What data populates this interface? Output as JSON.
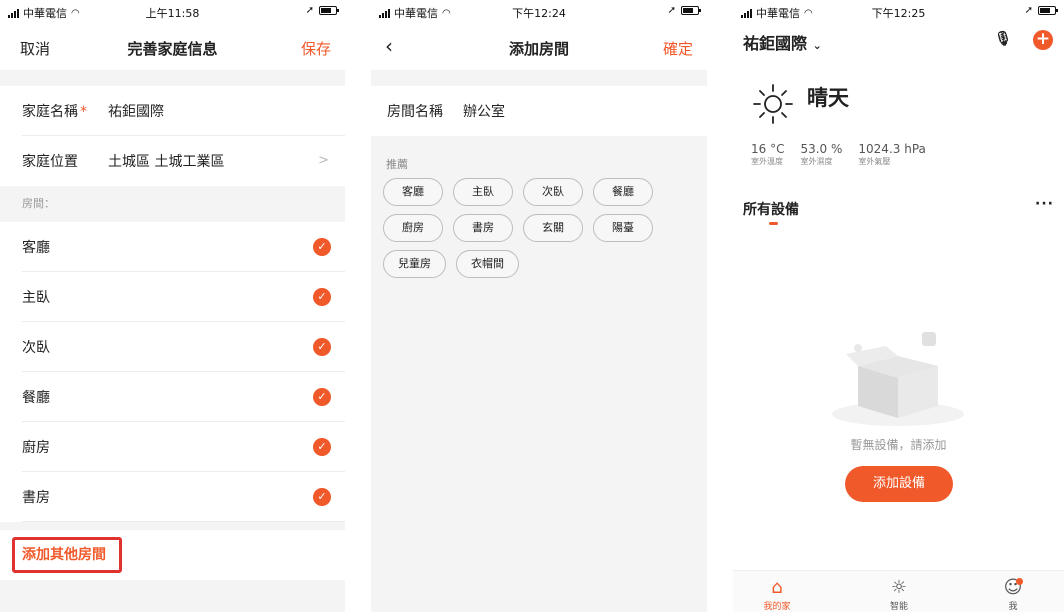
{
  "colors": {
    "accent": "#f0592a",
    "highlight_border": "#e0322e"
  },
  "screen1": {
    "status": {
      "carrier": "中華電信",
      "time": "上午11:58"
    },
    "nav": {
      "cancel": "取消",
      "title": "完善家庭信息",
      "save": "保存"
    },
    "family_name_label": "家庭名稱",
    "required_mark": "*",
    "family_name_value": "祐鉅國際",
    "location_label": "家庭位置",
    "location_value": "土城區 土城工業區",
    "rooms_header": "房間：",
    "rooms": [
      "客廳",
      "主臥",
      "次臥",
      "餐廳",
      "廚房",
      "書房"
    ],
    "add_other_room": "添加其他房間"
  },
  "screen2": {
    "status": {
      "carrier": "中華電信",
      "time": "下午12:24"
    },
    "nav": {
      "title": "添加房間",
      "confirm": "確定"
    },
    "room_name_label": "房間名稱",
    "room_name_value": "辦公室",
    "recommend_label": "推薦",
    "chips": [
      "客廳",
      "主臥",
      "次臥",
      "餐廳",
      "廚房",
      "書房",
      "玄關",
      "陽臺",
      "兒童房",
      "衣帽間"
    ]
  },
  "screen3": {
    "status": {
      "carrier": "中華電信",
      "time": "下午12:25"
    },
    "home_name": "祐鉅國際",
    "weather": "晴天",
    "stats": [
      {
        "value": "16 °C",
        "label": "室外溫度"
      },
      {
        "value": "53.0 %",
        "label": "室外濕度"
      },
      {
        "value": "1024.3 hPa",
        "label": "室外氣壓"
      }
    ],
    "all_devices": "所有設備",
    "empty_text": "暫無設備，請添加",
    "add_device": "添加設備",
    "tabs": [
      "我的家",
      "智能",
      "我"
    ]
  }
}
